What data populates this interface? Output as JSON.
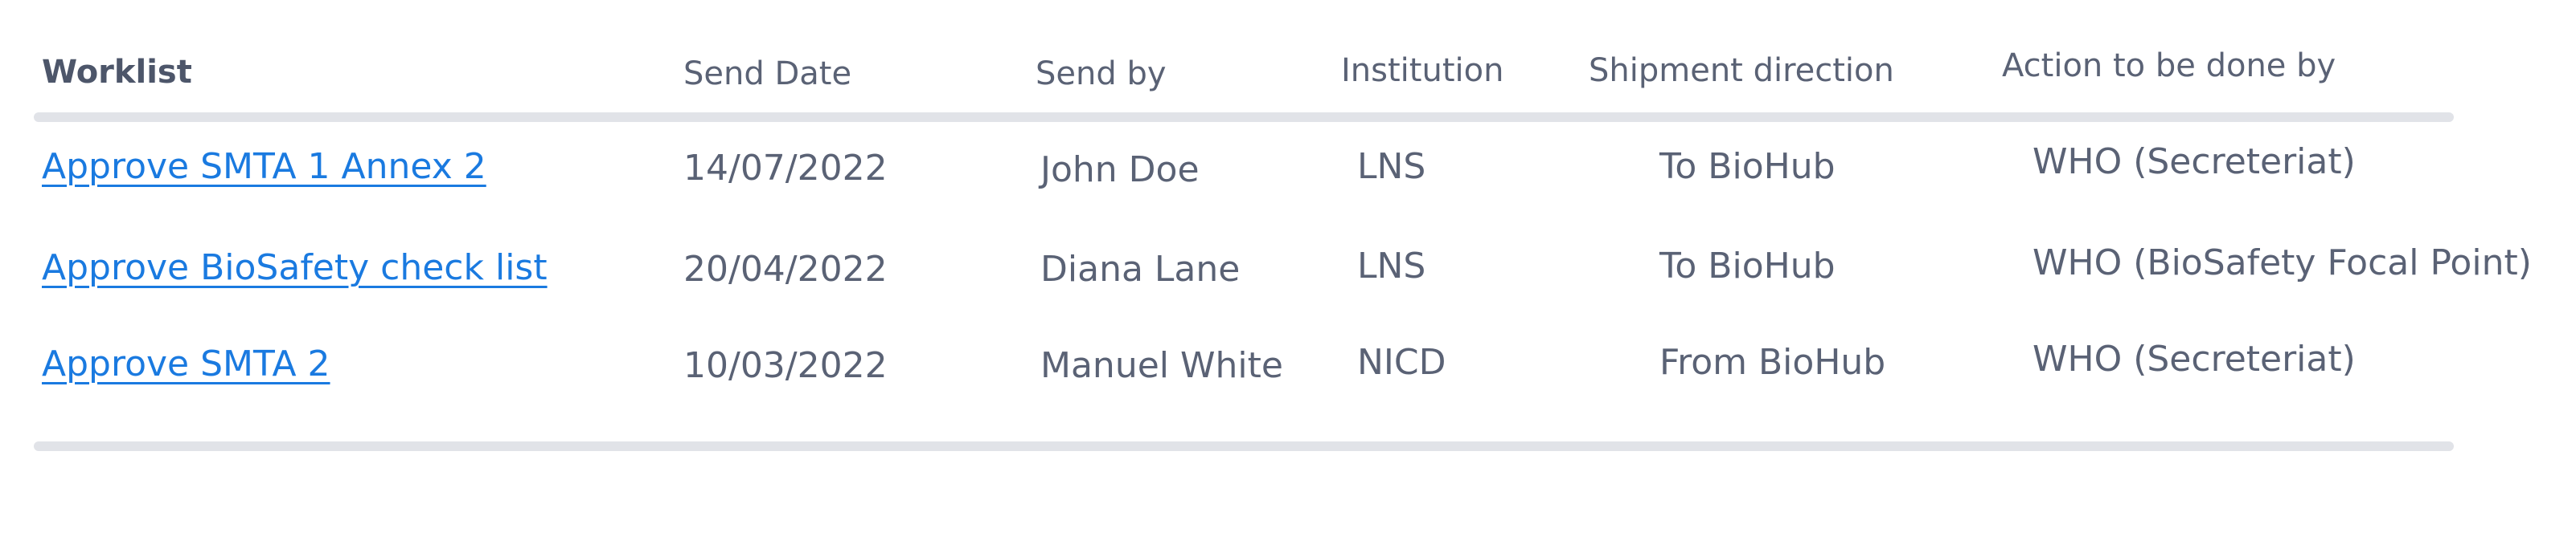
{
  "worklist": {
    "headers": {
      "worklist": "Worklist",
      "send_date": "Send Date",
      "send_by": "Send by",
      "institution": "Institution",
      "shipment_direction": "Shipment direction",
      "action_by": "Action to be done by"
    },
    "rows": [
      {
        "task": "Approve SMTA 1 Annex 2",
        "send_date": "14/07/2022",
        "send_by": "John Doe",
        "institution": "LNS",
        "direction": "To BioHub",
        "action_by": "WHO (Secreteriat)"
      },
      {
        "task": "Approve BioSafety check list",
        "send_date": "20/04/2022",
        "send_by": "Diana Lane",
        "institution": "LNS",
        "direction": "To BioHub",
        "action_by": "WHO (BioSafety Focal Point)"
      },
      {
        "task": "Approve SMTA 2",
        "send_date": "10/03/2022",
        "send_by": "Manuel White",
        "institution": "NICD",
        "direction": "From BioHub",
        "action_by": "WHO (Secreteriat)"
      }
    ],
    "colors": {
      "text": "#5a6275",
      "link": "#1a7ae0",
      "divider": "#e1e3e8"
    }
  }
}
